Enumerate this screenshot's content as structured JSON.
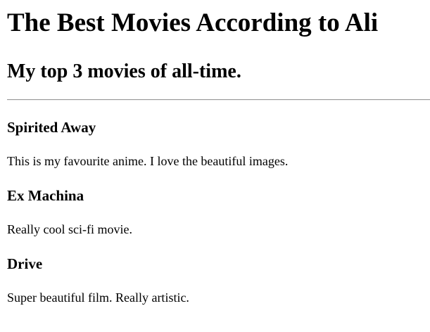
{
  "page": {
    "title": "The Best Movies According to Ali",
    "subtitle": "My top 3 movies of all-time."
  },
  "movies": [
    {
      "title": "Spirited Away",
      "description": "This is my favourite anime. I love the beautiful images."
    },
    {
      "title": "Ex Machina",
      "description": "Really cool sci-fi movie."
    },
    {
      "title": "Drive",
      "description": "Super beautiful film. Really artistic."
    }
  ]
}
